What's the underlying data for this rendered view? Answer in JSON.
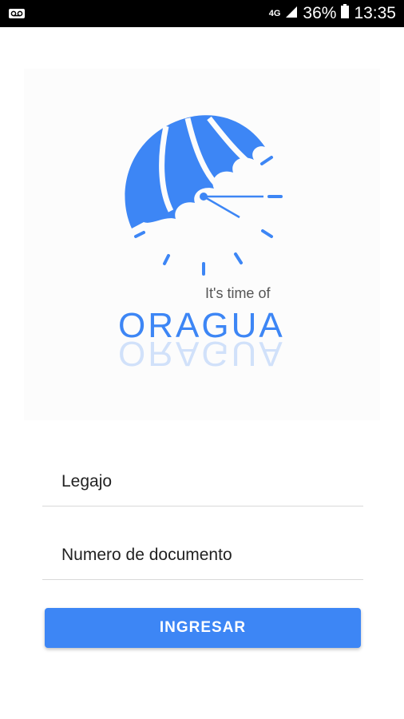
{
  "status_bar": {
    "network": "4G",
    "battery": "36%",
    "time": "13:35",
    "icons": [
      "voicemail-icon",
      "signal-icon",
      "battery-icon"
    ]
  },
  "logo": {
    "tagline": "It's time of",
    "brand": "ORAGUA",
    "accent_color": "#3d86f5"
  },
  "form": {
    "legajo_placeholder": "Legajo",
    "documento_placeholder": "Numero de documento",
    "submit_label": "INGRESAR"
  }
}
